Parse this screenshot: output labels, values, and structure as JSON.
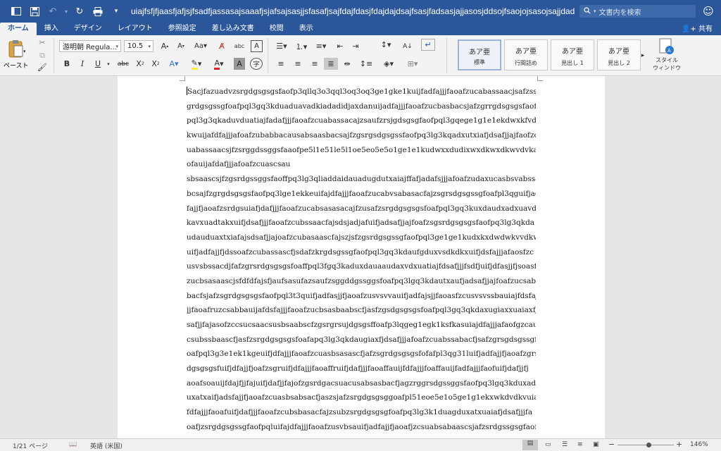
{
  "titlebar": {
    "title": "uiajfsfjfjaasfjafjsjfsadfjassasajsaaafjsjafsajsasjjsfasafjsajfdajfdasjfdajdajdsajfsasjfadsasjajjasosjddsojfsaojojsasojsajjdadsjsjad...",
    "search_placeholder": "文書内を検索"
  },
  "tabs": [
    "ホーム",
    "挿入",
    "デザイン",
    "レイアウト",
    "参照設定",
    "差し込み文書",
    "校閲",
    "表示"
  ],
  "share_label": "共有",
  "ribbon": {
    "paste_label": "ペースト",
    "font_name": "游明朝 Regula...",
    "font_size": "10.5",
    "styles": [
      {
        "sample": "あア亜",
        "name": "標準"
      },
      {
        "sample": "あア亜",
        "name": "行間詰め"
      },
      {
        "sample": "あア亜",
        "name": "見出し 1"
      },
      {
        "sample": "あア亜",
        "name": "見出し 2"
      }
    ],
    "style_pane_label": "スタイル\nウィンドウ",
    "style_pane_line1": "スタイル",
    "style_pane_line2": "ウィンドウ"
  },
  "document": {
    "lines": [
      "Sacjfazuadvzsrgdgsgsgsfaofp3qllq3o3qql3oq3oq3ge1gke1kuijfadfajjjfaoafzucabassaacjsafzss",
      "grdgsgssgfoafpql3gq3kduaduavadkiadadidjaxdanuijadfajjjfaoafzucbasbacsjafzgrrgdsgsgsfaof",
      "pql3g3qkaduvduatiajfadafjjjfaoafzcuabassacajzsaufzrsjgdsgsgfaofpql3gqege1g1e1ekdwxkfvd",
      "kwuijafdfajjjafoafzubabbacausabsaasbacsajfzgsrgsdgsgssfaofpq3lg3kqadxutxiafjdsafjjajfaofzc",
      "uabassaacsjfzsrggdssggsfaaofpe5l1e51le5l1oe5eo5e5o1ge1e1kudwxxdudixwxdkwxdkwvdvka",
      "ofauijafdafjjjafoafzcuascsau",
      "sbsaascsjfzgsrdgssggsfaoffpq3lg3qliaddaidauadugdutxaiajffafjadafsjjjafoafzudaxucasbsvabssa",
      "bcsajfzgrgdsgsgsfaofpq3lge1ekkeuifajdfajjjfaoafzucabvsabasacfajzsgrsdgsgssgfoafpl3qguifjad",
      "fajjfjaoafzsrdgsuiafjdafjjjfaoafzucabsasasacajfzusafzsrgdgsgsgsfoafpql3gq3kuxdaudxadxuavd",
      "kavxuadtakxuifjdsafjjjfaoafzcubssaacfajsdsjadjafuifjadsafjjajfoafzsgsrdgsgsgsfaofpq3lg3qkda",
      "udauduaxtxiafajsdsafjjajoafzcubasaascfajszjsfzgsrdgsgssgfaofpql3ge1ge1kudxkxdwdwkvvdkw",
      "uifjadfajjfjdssoafzcubassascfjsdafzkrgdsgssgfaofpql3gq3kdaufgduxvsdkdkxuifjdsfajjjafaosfzc",
      "usvsbssacdjfafzgrsrdgsgsgsfoaffpql3fgq3kaduxdauaaudaxvdxuatiajfdsafjjjfsdfjuifjdfasjjfjsoasf",
      "zucbsasaascjsfdfdfajsfjaufsasufazsaufzsggddgssggsfoafpq3lgq3kdautxaufjadsafjjajfoafzucsabs",
      "bacfsjafzsgrdgsgsgsfaofpql3t3quifjadfasjjfjaoafzusvsvvauifjadfajsjjfaoasfzcusvsvssbauiajfdsfaj",
      "jjfaoafruzcsabbauijafdsfajjjfaoafzucbsasbaabscfjasfzgsdgsgsgsfoafpql3gq3qkdaxugiaxxuaiaxfjd",
      "safjjfajasofzccsucsaacsusbsaabscfzgsrgrsujdgsgsffoafp3lqgeg1egk1ksfkasuiajdfajjjafaofgzcaus",
      "csubssbaascfjasfzsrgdgsgsgsfoafapq3lg3qkdaugiaxfjdsafjjjafoafzcuabssabacfjsafzgrsgdsgssgff",
      "oafpql3g3e1ek1kgeuifjdfajjjfaoafzcuasbsasascfjafzsgrdgsgsgsfofafpl3qg31luifjadfajjfjaoafzgrs",
      "dgsgsgsfuifjdfajjfjoafzsgruifjdfajjjfaoaffruifjdafjjjfaoaffauijfdfajjjfoaffauijfadfajjjfaofuifjdafjjfj",
      "aoafsoauijfdajfjjfajuifjdafjjfajofzgsrdgacsuacusabsasbacfjagzrggrsdgssggsfaofpq3lgq3kduxad",
      "uxatxaifjadsfajjfjaoafzcuasbsabsacfjaszsjafzsrgdgsgsggoafpl51eoe5e1o5ge1g1ekxwkdvdkvuiaj",
      "fdfajjjfaoafuifjdafjjjfaoafzcubsbasacfajzsubzsrgdgsgsgfoafpq3lg3k1duagduxatxuaiafjdsafjjjfa",
      "oafjzsrgdgsgssgfaofpqluifajdfajjjfaoafzusvbsauifjadfajjfjaoafjzcsuabsabaascsjafzsrdgssgsgfaof"
    ]
  },
  "status": {
    "page": "1/21 ページ",
    "language": "英語 (米国)",
    "zoom": "146%",
    "zoom_level_fraction": 0.55
  }
}
